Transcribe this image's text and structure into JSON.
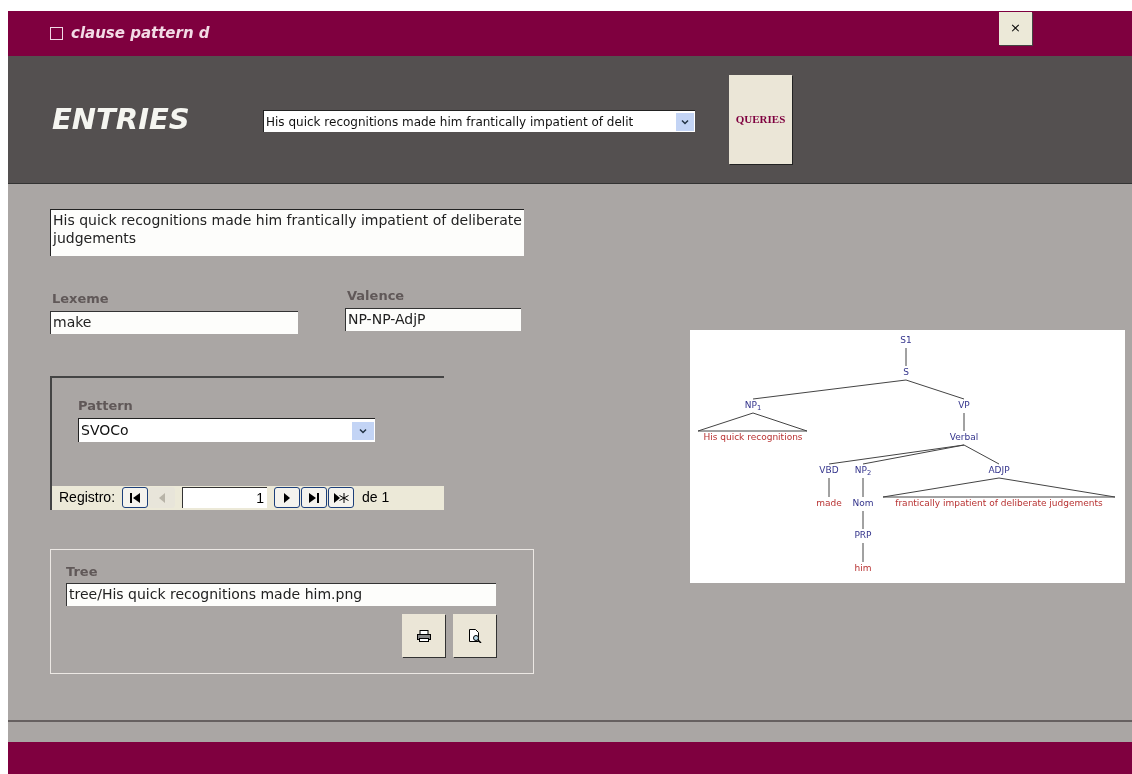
{
  "window": {
    "title": "clause pattern d",
    "close_button": "×"
  },
  "header": {
    "title": "ENTRIES",
    "entry_select": "His quick recognitions made him frantically impatient of delit",
    "queries_button": "QUERIES"
  },
  "form": {
    "sentence": "His quick recognitions made him frantically impatient of deliberate judgements",
    "lexeme": {
      "label": "Lexeme",
      "value": "make"
    },
    "valence": {
      "label": "Valence",
      "value": "NP-NP-AdjP"
    },
    "pattern": {
      "label": "Pattern",
      "value": "SVOCo"
    },
    "navigator": {
      "label": "Registro:",
      "current": "1",
      "of": "de",
      "total": "1",
      "buttons": [
        {
          "kind": "first",
          "disabled": false
        },
        {
          "kind": "prev",
          "disabled": true
        },
        {
          "kind": "next",
          "disabled": false
        },
        {
          "kind": "last",
          "disabled": false
        },
        {
          "kind": "new",
          "disabled": false
        }
      ]
    },
    "tree": {
      "label": "Tree",
      "path": "tree/His quick recognitions made him.png",
      "buttons": [
        {
          "kind": "print"
        },
        {
          "kind": "preview"
        }
      ]
    }
  },
  "tree_image": {
    "root": {
      "label": "S1",
      "kind": "node",
      "children": [
        {
          "label": "S",
          "kind": "node",
          "children": [
            {
              "label": "NP$_{1}$",
              "kind": "node",
              "children": [
                {
                  "label": "His quick recognitions",
                  "kind": "word",
                  "roof": true
                }
              ]
            },
            {
              "label": "VP",
              "kind": "node",
              "children": [
                {
                  "label": "Verbal",
                  "kind": "node",
                  "children": [
                    {
                      "label": "VBD",
                      "kind": "node",
                      "children": [
                        {
                          "label": "made",
                          "kind": "word"
                        }
                      ]
                    },
                    {
                      "label": "NP$_{2}$",
                      "kind": "node",
                      "children": [
                        {
                          "label": "Nom",
                          "kind": "node",
                          "children": [
                            {
                              "label": "PRP",
                              "kind": "node",
                              "children": [
                                {
                                  "label": "him",
                                  "kind": "word"
                                }
                              ]
                            }
                          ]
                        }
                      ]
                    },
                    {
                      "label": "ADJP",
                      "kind": "node",
                      "children": [
                        {
                          "label": "frantically impatient of deliberate judgements",
                          "kind": "word",
                          "roof": true
                        }
                      ]
                    }
                  ]
                }
              ]
            }
          ]
        }
      ]
    }
  }
}
